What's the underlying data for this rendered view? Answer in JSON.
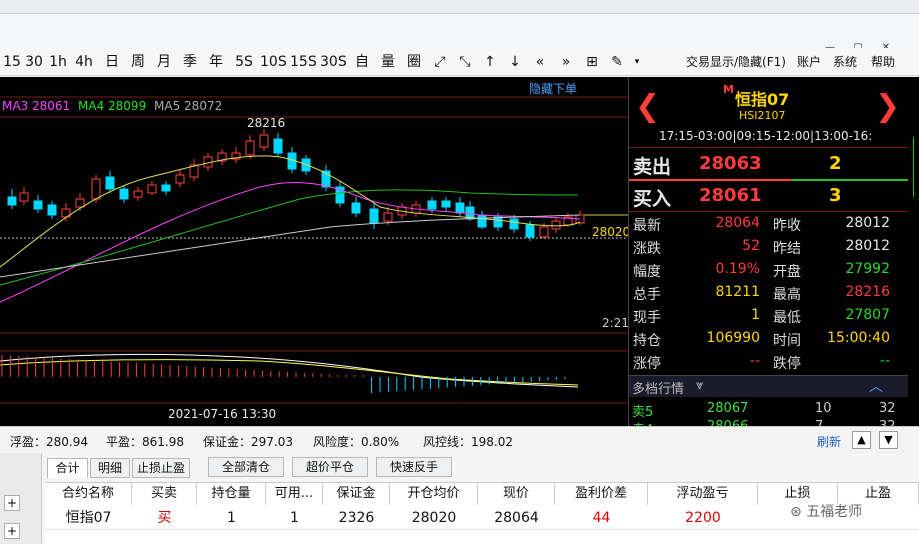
{
  "toolbar": {
    "periods": [
      "15",
      "30",
      "1h",
      "4h",
      "日",
      "周",
      "月",
      "季",
      "年",
      "5S",
      "10S",
      "15S",
      "30S",
      "自",
      "量",
      "圈"
    ],
    "right_menu": [
      "交易显示/隐藏(F1)",
      "账户",
      "系统",
      "帮助"
    ]
  },
  "chart": {
    "ma_legend": [
      {
        "label": "MA3 28061",
        "color": "#ff40ff"
      },
      {
        "label": "MA4 28099",
        "color": "#20e020"
      },
      {
        "label": "MA5 28072",
        "color": "#aaaaaa"
      }
    ],
    "hide_order_link": "隐藏下单",
    "high_label": "28216",
    "price_line_label": "28020",
    "time_marker": "2:21",
    "date_label": "2021-07-16 13:30"
  },
  "quote": {
    "contract_prefix": "M",
    "contract_name": "恒指07",
    "contract_code": "HSI2107",
    "sessions": "17:15-03:00|09:15-12:00|13:00-16:",
    "ask": {
      "label": "卖出",
      "price": "28063",
      "qty": "2"
    },
    "bid": {
      "label": "买入",
      "price": "28061",
      "qty": "3"
    },
    "rows": [
      {
        "l1": "最新",
        "v1": "28064",
        "c1": "red",
        "l2": "昨收",
        "v2": "28012",
        "c2": "wht"
      },
      {
        "l1": "涨跌",
        "v1": "52",
        "c1": "red",
        "l2": "昨结",
        "v2": "28012",
        "c2": "wht"
      },
      {
        "l1": "幅度",
        "v1": "0.19%",
        "c1": "red",
        "l2": "开盘",
        "v2": "27992",
        "c2": "grn"
      },
      {
        "l1": "总手",
        "v1": "81211",
        "c1": "yel",
        "l2": "最高",
        "v2": "28216",
        "c2": "red"
      },
      {
        "l1": "现手",
        "v1": "1",
        "c1": "yel",
        "l2": "最低",
        "v2": "27807",
        "c2": "grn"
      },
      {
        "l1": "持仓",
        "v1": "106990",
        "c1": "yel",
        "l2": "时间",
        "v2": "15:00:40",
        "c2": "yel"
      },
      {
        "l1": "涨停",
        "v1": "--",
        "c1": "red",
        "l2": "跌停",
        "v2": "--",
        "c2": "grn"
      }
    ],
    "depth_header": "多档行情",
    "depth_rows": [
      {
        "label": "卖5",
        "price": "28067",
        "qty": "10",
        "extra": "32"
      },
      {
        "label": "卖4",
        "price": "28066",
        "qty": "7",
        "extra": "32"
      }
    ]
  },
  "status": {
    "items": [
      {
        "label": "浮盈：280.94"
      },
      {
        "label": "平盈：861.98"
      },
      {
        "label": "保证金：297.03"
      },
      {
        "label": "风险度：0.80%"
      },
      {
        "label": "风控线：198.02"
      }
    ],
    "refresh": "刷新"
  },
  "bottom": {
    "tabs": [
      "合计",
      "明细",
      "止损止盈"
    ],
    "actions": [
      "全部清仓",
      "超价平仓",
      "快速反手"
    ],
    "columns": [
      "合约名称",
      "买卖",
      "持仓量",
      "可用...",
      "保证金",
      "开仓均价",
      "现价",
      "盈利价差",
      "浮动盈亏",
      "止损",
      "止盈"
    ],
    "row": [
      "恒指07",
      "买",
      "1",
      "1",
      "2326",
      "28020",
      "28064",
      "44",
      "2200",
      "",
      ""
    ],
    "watermark": "五福老师"
  }
}
